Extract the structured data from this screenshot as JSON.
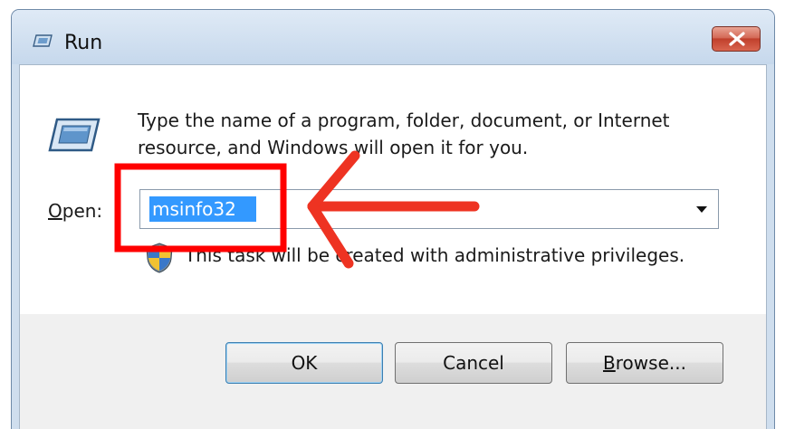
{
  "window": {
    "title": "Run",
    "icon": "run-icon",
    "close_icon": "close-icon"
  },
  "description": "Type the name of a program, folder, document, or Internet resource, and Windows will open it for you.",
  "open_field": {
    "label": "Open:",
    "label_accesskey": "O",
    "label_rest": "pen:",
    "value": "msinfo32"
  },
  "admin_note": "This task will be created with administrative privileges.",
  "buttons": {
    "ok": "OK",
    "cancel": "Cancel",
    "browse_accesskey": "B",
    "browse_rest": "rowse..."
  },
  "annotation": {
    "highlight_color": "#ff0000",
    "arrow_color": "#ee3322"
  }
}
